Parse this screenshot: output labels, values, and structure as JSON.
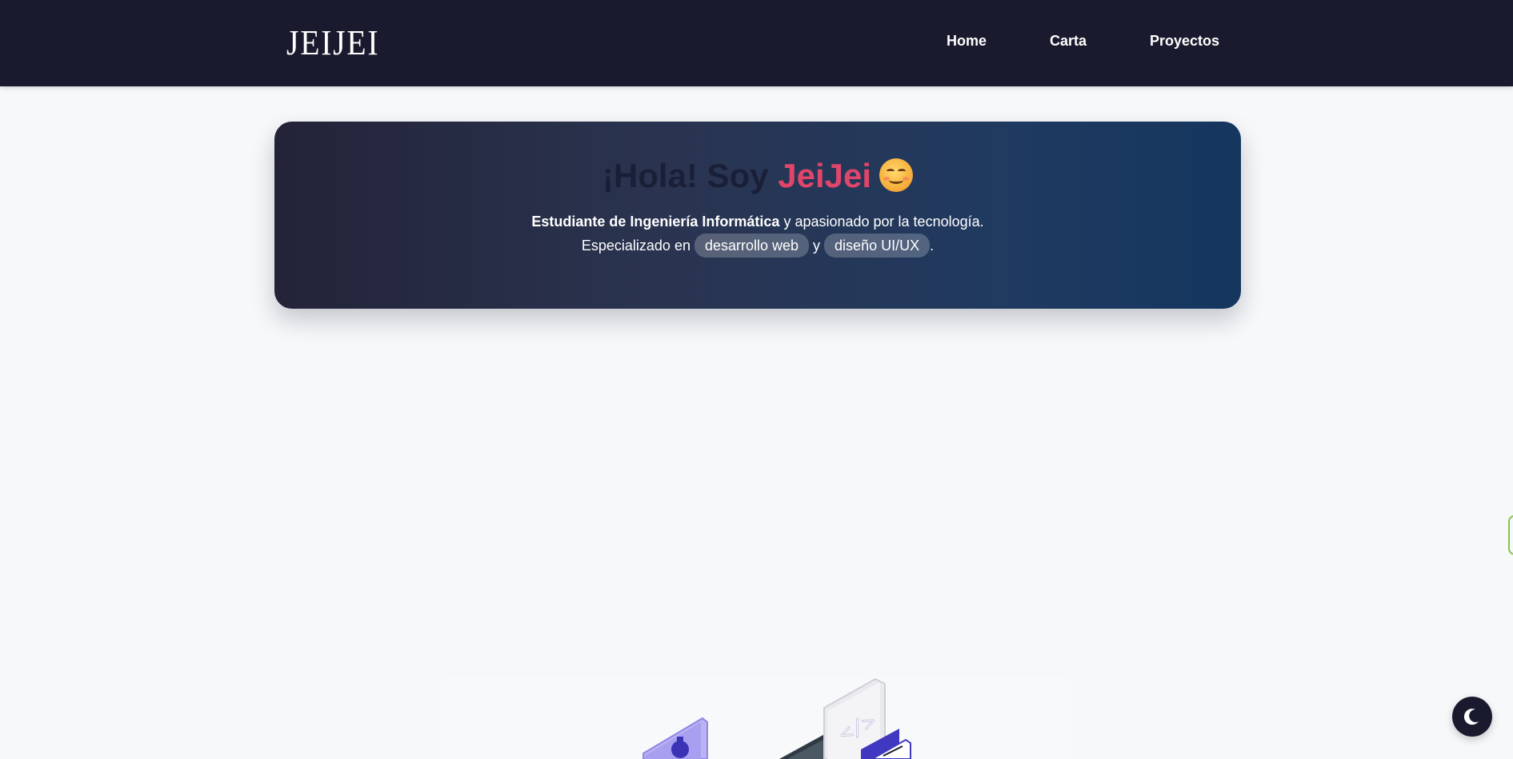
{
  "navbar": {
    "logo": "JEIJEI",
    "links": [
      {
        "label": "Home"
      },
      {
        "label": "Carta"
      },
      {
        "label": "Proyectos"
      }
    ]
  },
  "hero": {
    "title_greeting": "¡Hola! Soy ",
    "title_name": "JeiJei",
    "title_emoji_icon": "smiling-face-emoji-icon",
    "line1_bold": "Estudiante de Ingeniería Informática",
    "line1_rest": " y apasionado por la tecnología.",
    "line2_prefix": "Especializado en ",
    "skill_1": "desarrollo web",
    "connector": " y ",
    "skill_2": "diseño UI/UX",
    "line2_suffix": "."
  },
  "illustration": {
    "icons": [
      "gear-panel-icon",
      "code-screen-icon",
      "browser-window-icon"
    ]
  },
  "theme_toggle": {
    "icon": "moon-icon"
  },
  "colors": {
    "navbar_bg": "#1a1a2e",
    "accent_name": "#e0456a",
    "page_bg": "#f6f8fa",
    "side_tab_border": "#8bc34a"
  }
}
